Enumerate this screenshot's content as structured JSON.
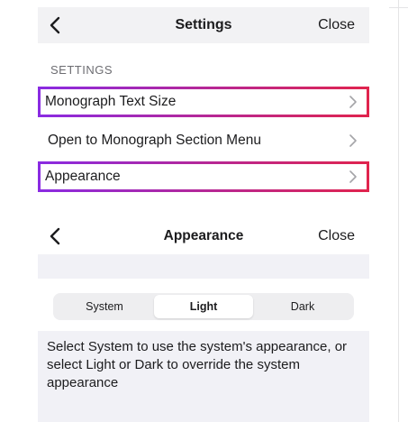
{
  "settings_screen": {
    "title": "Settings",
    "close_label": "Close",
    "section_header": "SETTINGS",
    "rows": [
      {
        "label": "Monograph Text Size"
      },
      {
        "label": "Open to Monograph Section Menu"
      },
      {
        "label": "Appearance"
      }
    ]
  },
  "appearance_screen": {
    "title": "Appearance",
    "close_label": "Close",
    "segments": [
      "System",
      "Light",
      "Dark"
    ],
    "selected_segment": "Light",
    "description": "Select System to use the system's appearance, or select Light or Dark to override the system appearance"
  },
  "colors": {
    "highlight_start": "#8a2be2",
    "highlight_end": "#e0244e",
    "nav_background": "#f2f2f4",
    "grouped_background": "#f1f1f6"
  },
  "icons": {
    "back": "chevron-left-icon",
    "disclosure": "chevron-right-icon"
  }
}
